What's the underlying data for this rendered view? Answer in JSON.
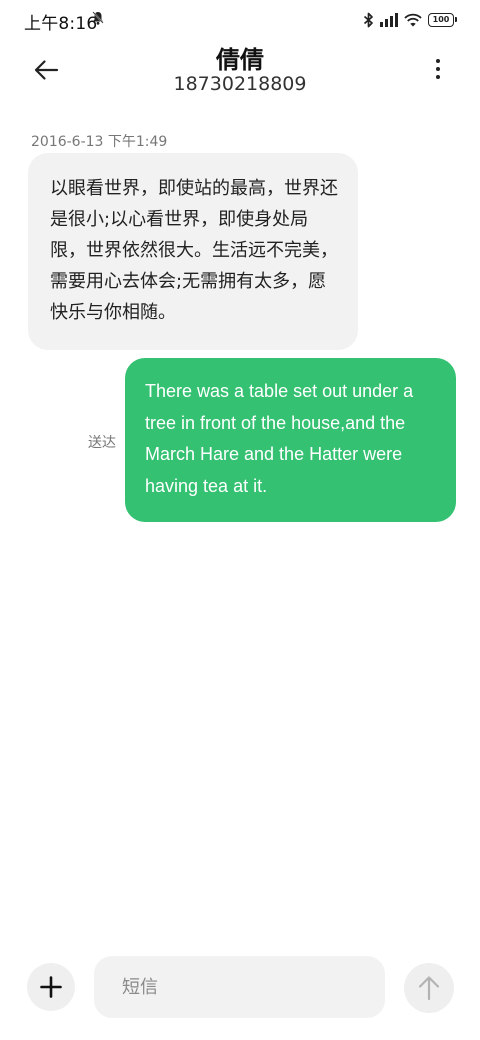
{
  "status_bar": {
    "time": "上午8:16",
    "battery": "100",
    "icons": [
      "dnd-bell-icon",
      "bluetooth-icon",
      "signal-icon",
      "wifi-icon",
      "battery-icon"
    ]
  },
  "header": {
    "contact_name": "倩倩",
    "phone_number": "18730218809",
    "back_icon": "arrow-left-icon",
    "more_icon": "more-vertical-icon"
  },
  "messages": [
    {
      "direction": "incoming",
      "timestamp": "2016-6-13 下午1:49",
      "text": "以眼看世界，即使站的最高，世界还是很小;以心看世界，即使身处局限，世界依然很大。生活远不完美，需要用心去体会;无需拥有太多，愿快乐与你相随。"
    },
    {
      "direction": "outgoing",
      "status": "送达",
      "text": "There was a table set out under a tree in front of the house,and the March Hare and the Hatter were having tea at it."
    }
  ],
  "composer": {
    "placeholder": "短信",
    "value": "",
    "add_icon": "plus-icon",
    "send_icon": "arrow-up-icon"
  },
  "colors": {
    "outgoing_bubble": "#34c172",
    "incoming_bubble": "#f2f2f2",
    "background": "#ffffff"
  }
}
